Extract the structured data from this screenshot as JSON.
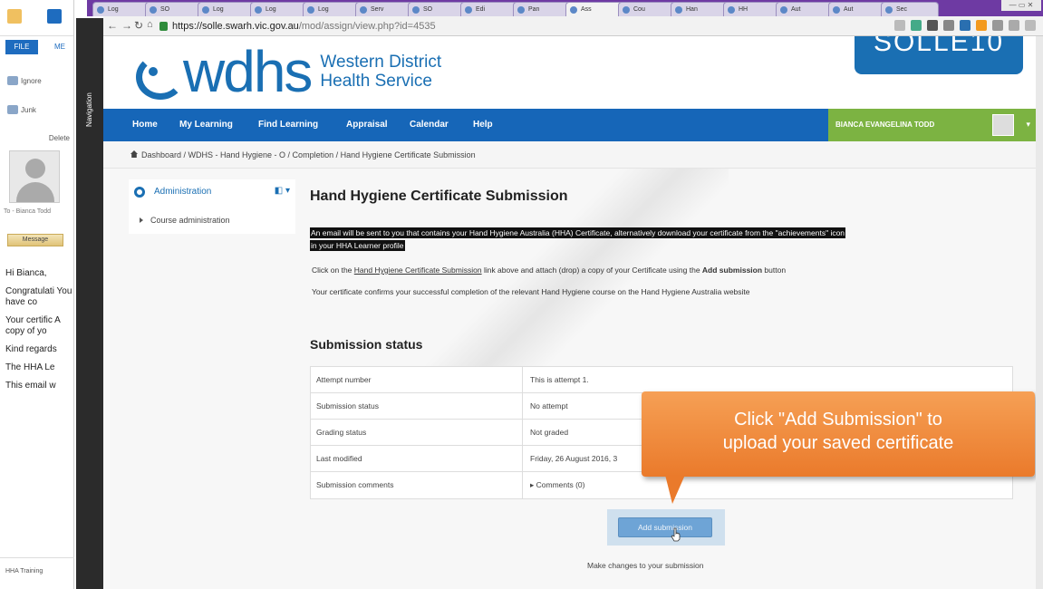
{
  "outlook": {
    "file_tab": "FILE",
    "message_tab": "ME",
    "ignore": "Ignore",
    "junk": "Junk",
    "delete": "Delete",
    "sender": "To - Bianca Todd",
    "message_button": "Message",
    "body": [
      "Hi Bianca,",
      "Congratulati You have co",
      "Your certific A copy of yo",
      "Kind regards",
      "The HHA Le",
      "This email w"
    ],
    "bottom_item": "HHA Training"
  },
  "nav_strip": "Navigation",
  "browser": {
    "tabs": [
      "Log",
      "SO",
      "Log",
      "Log",
      "Log",
      "Serv",
      "SO",
      "Edi",
      "Pan",
      "Ass",
      "Cou",
      "Han",
      "HH",
      "Aut",
      "Aut",
      "Sec"
    ],
    "url_host": "https://solle.swarh.vic.gov.au",
    "url_path": "/mod/assign/view.php?id=4535"
  },
  "site": {
    "logo_text": "wdhs",
    "logo_sub1": "Western District",
    "logo_sub2": "Health Service",
    "badge": "SOLLE10"
  },
  "nav": {
    "items": [
      "Home",
      "My Learning",
      "Find Learning",
      "Appraisal",
      "Calendar",
      "Help"
    ],
    "user": "BIANCA EVANGELINA TODD"
  },
  "breadcrumb": "Dashboard / WDHS - Hand Hygiene - O / Completion / Hand Hygiene Certificate Submission",
  "sidebar": {
    "title": "Administration",
    "item": "Course administration"
  },
  "main": {
    "title": "Hand Hygiene Certificate Submission",
    "highlight_line1": "An email will be sent to you that contains your Hand Hygiene Australia (HHA) Certificate, alternatively download your certificate from the \"achievements\" icon",
    "highlight_line2": "in your HHA Learner profile",
    "para1_pre": "Click on the ",
    "para1_link": "Hand Hygiene Certificate Submission",
    "para1_mid": " link above and attach (drop) a copy of your Certificate using the ",
    "para1_bold": "Add submission",
    "para1_post": " button",
    "para2": "Your certificate confirms your successful completion of the relevant Hand Hygiene course on the Hand Hygiene Australia website",
    "status_title": "Submission status",
    "rows": [
      {
        "k": "Attempt number",
        "v": "This is attempt 1."
      },
      {
        "k": "Submission status",
        "v": "No attempt"
      },
      {
        "k": "Grading status",
        "v": "Not graded"
      },
      {
        "k": "Last modified",
        "v": "Friday, 26 August 2016, 3"
      },
      {
        "k": "Submission comments",
        "v": "▸ Comments (0)"
      }
    ],
    "add_button": "Add submission",
    "make_changes": "Make changes to your submission"
  },
  "callout": {
    "line1": "Click \"Add Submission\" to",
    "line2": "upload your saved certificate"
  },
  "colors": {
    "nav_blue": "#1666b8",
    "user_green": "#7cb342",
    "callout_orange": "#ea7a2b",
    "tabbar_purple": "#6e3aa3"
  }
}
